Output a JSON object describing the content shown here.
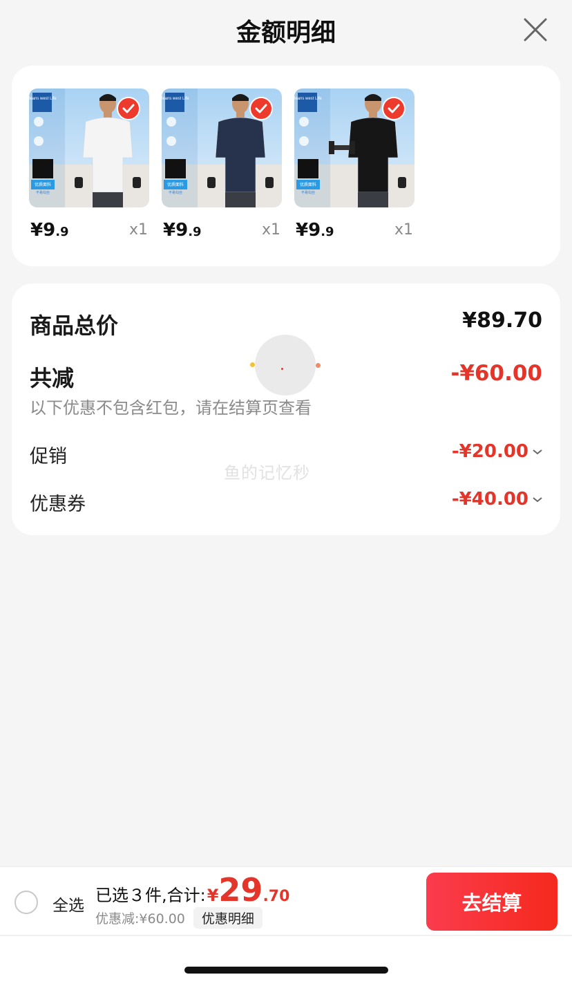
{
  "header": {
    "title": "金额明细",
    "close_icon": "close-icon"
  },
  "products": [
    {
      "price_int": "¥9",
      "price_dec": ".9",
      "qty": "x1",
      "shirt_color": "#f4f4f4",
      "selected": true
    },
    {
      "price_int": "¥9",
      "price_dec": ".9",
      "qty": "x1",
      "shirt_color": "#27324d",
      "selected": true
    },
    {
      "price_int": "¥9",
      "price_dec": ".9",
      "qty": "x1",
      "shirt_color": "#161616",
      "selected": true
    }
  ],
  "thumb_badge": {
    "brand": "Jeans west Life",
    "feature": "优质面料",
    "feature_sub": "不易勾丝"
  },
  "detail": {
    "total_label": "商品总价",
    "total_value": "¥89.70",
    "reduce_label": "共减",
    "reduce_value": "-¥60.00",
    "hint": "以下优惠不包含红包，请在结算页查看",
    "promo_label": "促销",
    "promo_value": "-¥20.00",
    "coupon_label": "优惠券",
    "coupon_value": "-¥40.00"
  },
  "watermark": "鱼的记忆秒",
  "bottom": {
    "select_all": "全选",
    "selected_text": "已选３件,合计:",
    "total_currency": "¥",
    "total_int": "29",
    "total_frac": ".70",
    "discount_text": "优惠减:¥60.00",
    "discount_detail": "优惠明细",
    "checkout": "去结算"
  },
  "colors": {
    "accent": "#e4352a",
    "checkout_start": "#fb3c4d",
    "checkout_end": "#f5291d",
    "background": "#f5f5f5"
  }
}
